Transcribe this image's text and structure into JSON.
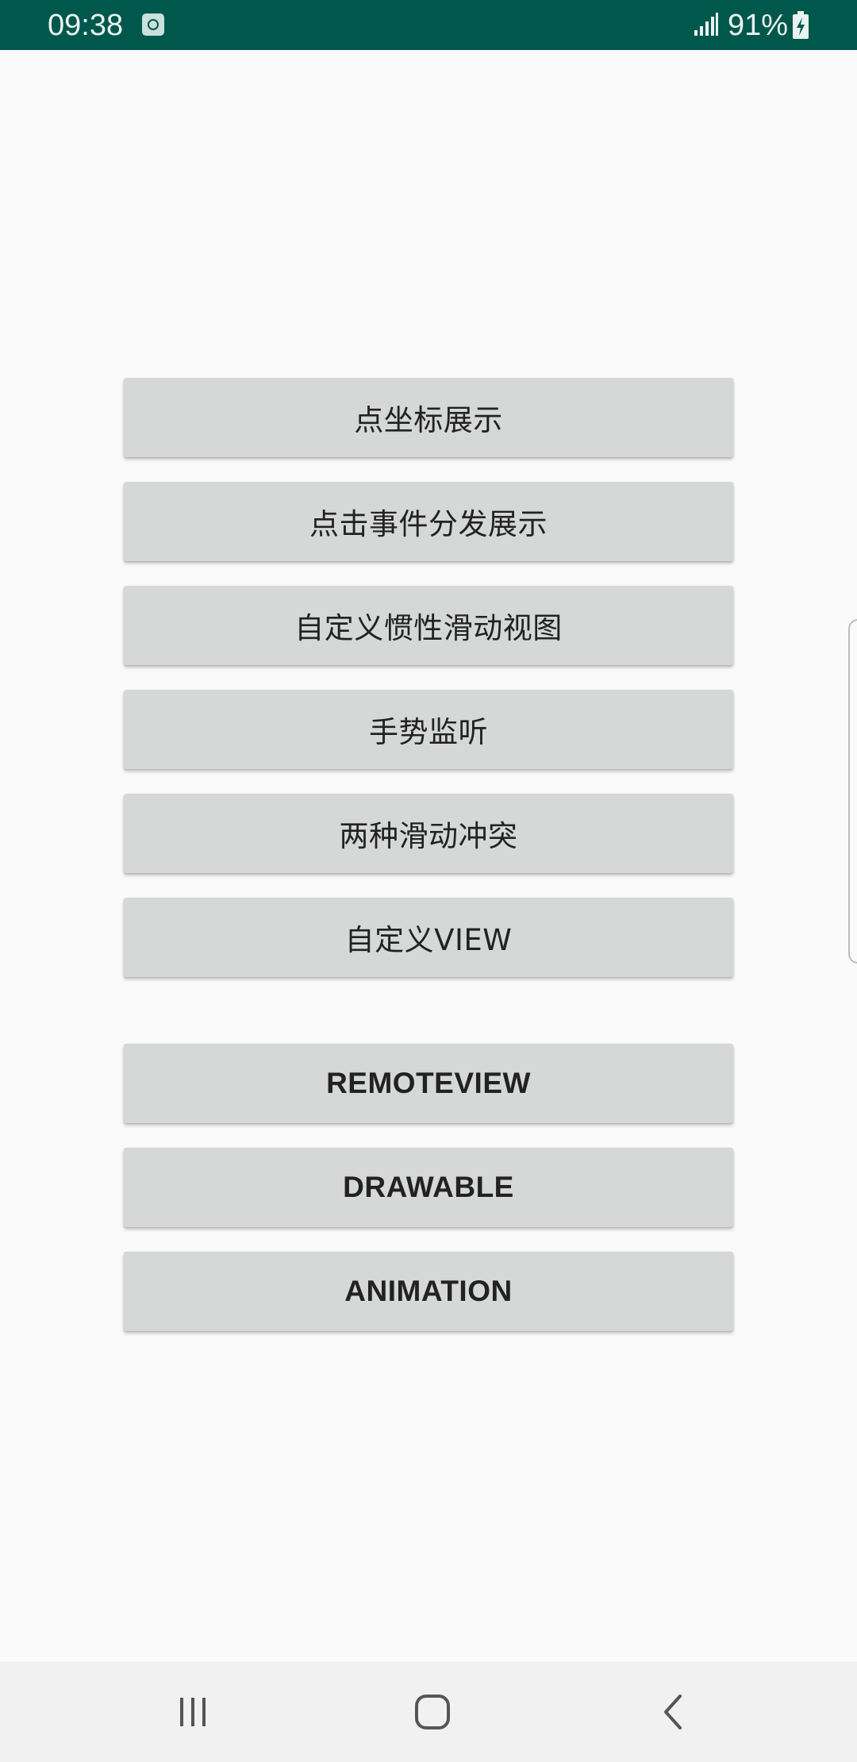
{
  "status_bar": {
    "time": "09:38",
    "battery_percent": "91%",
    "icons": [
      "app-notification-icon",
      "signal-icon",
      "battery-charging-icon"
    ],
    "background_color": "#00574b"
  },
  "buttons": [
    {
      "label": "点坐标展示"
    },
    {
      "label": "点击事件分发展示"
    },
    {
      "label": "自定义惯性滑动视图"
    },
    {
      "label": "手势监听"
    },
    {
      "label": "两种滑动冲突"
    },
    {
      "label": "自定义VIEW"
    },
    {
      "label": "REMOTEVIEW"
    },
    {
      "label": "DRAWABLE"
    },
    {
      "label": "ANIMATION"
    }
  ],
  "nav_bar": {
    "icons": [
      "recent-apps-icon",
      "home-icon",
      "back-icon"
    ]
  }
}
